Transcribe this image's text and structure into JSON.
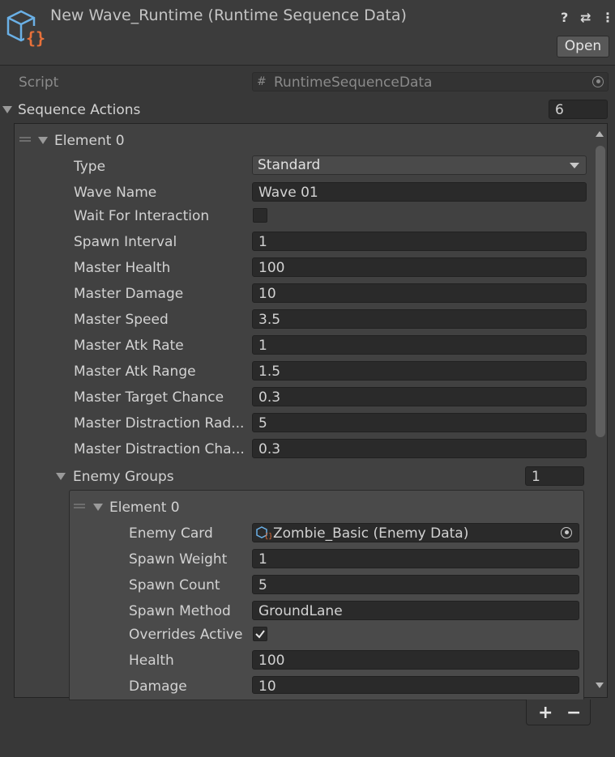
{
  "header": {
    "title": "New Wave_Runtime (Runtime Sequence Data)",
    "open_label": "Open",
    "help_icon": "?",
    "settings_icon": "⇄",
    "menu_icon": "⋮"
  },
  "script_row": {
    "label": "Script",
    "value": "RuntimeSequenceData"
  },
  "sequence_actions": {
    "label": "Sequence Actions",
    "count": "6"
  },
  "element0": {
    "label": "Element 0",
    "fields": {
      "type": {
        "label": "Type",
        "value": "Standard"
      },
      "wave_name": {
        "label": "Wave Name",
        "value": "Wave 01"
      },
      "wait_for_interaction": {
        "label": "Wait For Interaction",
        "checked": false
      },
      "spawn_interval": {
        "label": "Spawn Interval",
        "value": "1"
      },
      "master_health": {
        "label": "Master Health",
        "value": "100"
      },
      "master_damage": {
        "label": "Master Damage",
        "value": "10"
      },
      "master_speed": {
        "label": "Master Speed",
        "value": "3.5"
      },
      "master_atk_rate": {
        "label": "Master Atk Rate",
        "value": "1"
      },
      "master_atk_range": {
        "label": "Master Atk Range",
        "value": "1.5"
      },
      "master_target_chance": {
        "label": "Master Target Chance",
        "value": "0.3"
      },
      "master_distraction_radius": {
        "label": "Master Distraction Rad...",
        "value": "5"
      },
      "master_distraction_chance": {
        "label": "Master Distraction Cha...",
        "value": "0.3"
      }
    },
    "enemy_groups": {
      "label": "Enemy Groups",
      "count": "1",
      "element0": {
        "label": "Element 0",
        "fields": {
          "enemy_card": {
            "label": "Enemy Card",
            "value": "Zombie_Basic (Enemy Data)"
          },
          "spawn_weight": {
            "label": "Spawn Weight",
            "value": "1"
          },
          "spawn_count": {
            "label": "Spawn Count",
            "value": "5"
          },
          "spawn_method": {
            "label": "Spawn Method",
            "value": "GroundLane"
          },
          "overrides_active": {
            "label": "Overrides Active",
            "checked": true
          },
          "health": {
            "label": "Health",
            "value": "100"
          },
          "damage": {
            "label": "Damage",
            "value": "10"
          }
        }
      }
    }
  },
  "list_controls": {
    "add": "+",
    "remove": "−"
  },
  "colors": {
    "background": "#383838",
    "field": "#2a2a2a",
    "accent_orange": "#e8713a",
    "accent_blue": "#6ab0e6"
  }
}
